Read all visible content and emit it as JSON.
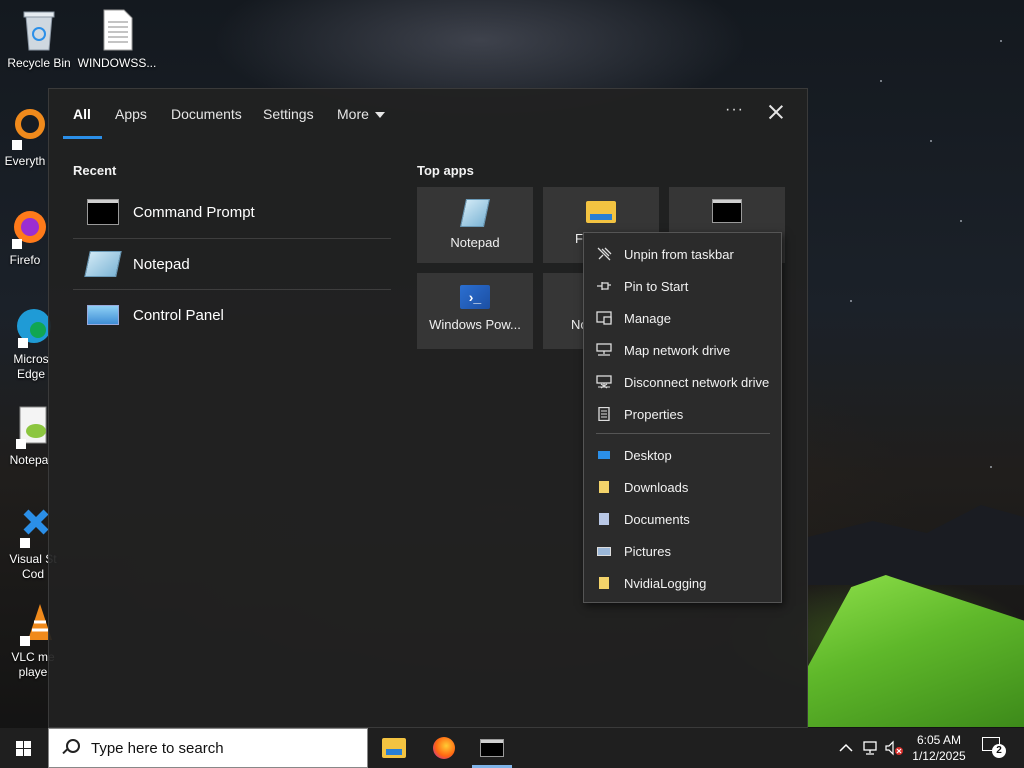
{
  "desktop": {
    "icons": [
      {
        "label": "Recycle Bin"
      },
      {
        "label": "WINDOWSS..."
      },
      {
        "label": "Everyth"
      },
      {
        "label": "Firefo"
      },
      {
        "label": "Micros\nEdge"
      },
      {
        "label": "Notepa"
      },
      {
        "label": "Visual St\nCod"
      },
      {
        "label": "VLC me\nplaye"
      }
    ]
  },
  "search_panel": {
    "tabs": [
      {
        "label": "All"
      },
      {
        "label": "Apps"
      },
      {
        "label": "Documents"
      },
      {
        "label": "Settings"
      },
      {
        "label": "More"
      }
    ],
    "more_icon": "ellipsis-icon",
    "close_icon": "close-icon",
    "recent_title": "Recent",
    "recent": [
      {
        "label": "Command Prompt",
        "icon": "command-prompt-icon"
      },
      {
        "label": "Notepad",
        "icon": "notepad-icon"
      },
      {
        "label": "Control Panel",
        "icon": "control-panel-icon"
      }
    ],
    "top_apps_title": "Top apps",
    "top_apps": [
      {
        "label": "Notepad",
        "icon": "notepad-icon"
      },
      {
        "label": "File",
        "icon": "file-explorer-icon"
      },
      {
        "label": "",
        "icon": "command-prompt-icon"
      },
      {
        "label": "Windows Pow...",
        "icon": "powershell-icon"
      },
      {
        "label": "No",
        "icon": "notepad-icon"
      }
    ]
  },
  "context_menu": {
    "items": [
      {
        "label": "Unpin from taskbar",
        "icon": "unpin-icon"
      },
      {
        "label": "Pin to Start",
        "icon": "pin-icon"
      },
      {
        "label": "Manage",
        "icon": "manage-icon"
      },
      {
        "label": "Map network drive",
        "icon": "map-drive-icon"
      },
      {
        "label": "Disconnect network drive",
        "icon": "disconnect-drive-icon"
      },
      {
        "label": "Properties",
        "icon": "properties-icon"
      }
    ],
    "places": [
      {
        "label": "Desktop",
        "icon": "desktop-folder-icon"
      },
      {
        "label": "Downloads",
        "icon": "folder-icon"
      },
      {
        "label": "Documents",
        "icon": "document-icon"
      },
      {
        "label": "Pictures",
        "icon": "pictures-icon"
      },
      {
        "label": "NvidiaLogging",
        "icon": "folder-icon"
      }
    ]
  },
  "taskbar": {
    "search_placeholder": "Type here to search",
    "time": "6:05 AM",
    "date": "1/12/2025",
    "notification_count": "2"
  }
}
